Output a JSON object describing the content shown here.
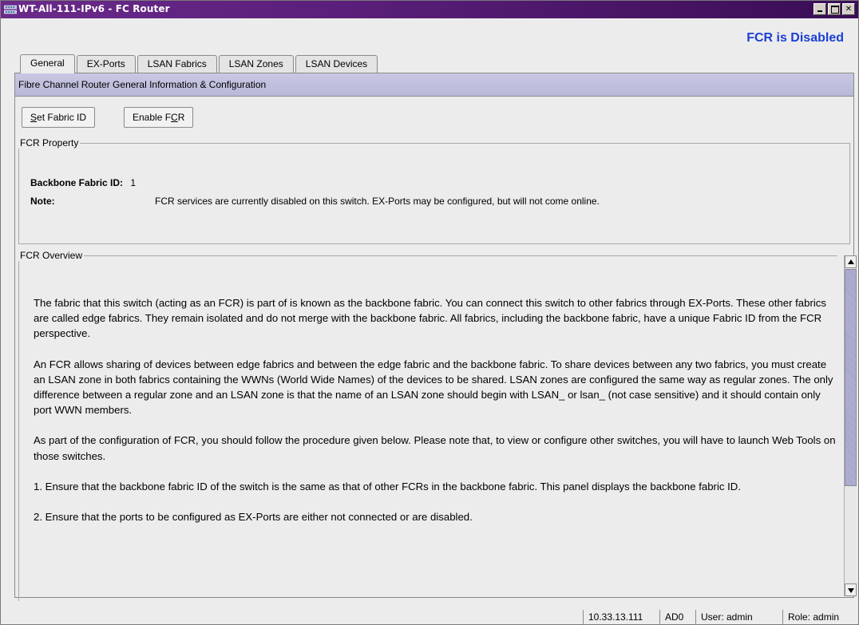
{
  "window": {
    "title": "WT-All-111-IPv6 - FC Router",
    "min_label": "",
    "max_label": "",
    "close_label": "✕"
  },
  "status": {
    "fcr_state": "FCR is Disabled",
    "color": "#1a3fd6"
  },
  "tabs": [
    {
      "label": "General",
      "active": true
    },
    {
      "label": "EX-Ports"
    },
    {
      "label": "LSAN Fabrics"
    },
    {
      "label": "LSAN Zones"
    },
    {
      "label": "LSAN Devices"
    }
  ],
  "general": {
    "header": "Fibre Channel Router General Information & Configuration",
    "buttons": {
      "set_fabric_id_pre": "",
      "set_fabric_id_u": "S",
      "set_fabric_id_post": "et Fabric ID",
      "enable_fcr_pre": "Enable F",
      "enable_fcr_u": "C",
      "enable_fcr_post": "R"
    },
    "property": {
      "legend": "FCR Property",
      "backbone_label": "Backbone Fabric ID:",
      "backbone_value": "1",
      "note_label": "Note:",
      "note_value": "FCR services are currently disabled on this switch. EX-Ports may be configured, but will not come online."
    },
    "overview": {
      "legend": "FCR Overview",
      "paragraphs": [
        "The fabric that this switch (acting as an FCR) is part of is known as the backbone fabric. You can connect this switch to other fabrics through EX-Ports. These other fabrics are called edge fabrics. They remain isolated and do not merge with the backbone fabric. All fabrics, including the backbone fabric, have a unique Fabric ID from the FCR perspective.",
        "An FCR allows sharing of devices between edge fabrics and between the edge fabric and the backbone fabric. To share devices between any two fabrics, you must create an LSAN zone in both fabrics containing the WWNs (World Wide Names) of the devices to be shared. LSAN zones are configured the same way as regular zones. The only difference between a regular zone and an LSAN zone is that the name of an LSAN zone should begin with LSAN_ or lsan_ (not case sensitive) and it should contain only port WWN members.",
        "As part of the configuration of FCR, you should follow the procedure given below. Please note that, to view or configure other switches, you will have to launch Web Tools on those switches.",
        "1. Ensure that the backbone fabric ID of the switch is the same as that of other FCRs in the backbone fabric. This panel displays the backbone fabric ID.",
        "2. Ensure that the ports to be configured as EX-Ports are either not connected or are disabled."
      ]
    }
  },
  "statusbar": {
    "ip": "10.33.13.111",
    "ad": "AD0",
    "user": "User: admin",
    "role": "Role: admin"
  }
}
